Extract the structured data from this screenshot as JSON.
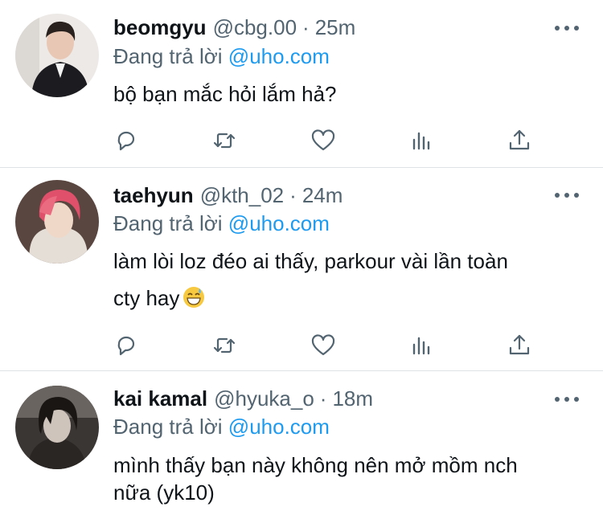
{
  "reply_prefix": "Đang trả lời",
  "colors": {
    "link": "#1d9bf0",
    "secondary": "#536471",
    "text": "#0f1419",
    "divider": "#dfe3e6"
  },
  "icons": [
    "reply-icon",
    "retweet-icon",
    "like-icon",
    "stats-icon",
    "share-icon",
    "more-icon"
  ],
  "tweets": [
    {
      "name": "beomgyu",
      "handle": "@cbg.00",
      "time": "25m",
      "reply_to": "@uho.com",
      "lines": [
        "bộ bạn mắc hỏi lắm hả?"
      ]
    },
    {
      "name": "taehyun",
      "handle": "@kth_02",
      "time": "24m",
      "reply_to": "@uho.com",
      "lines": [
        "làm lòi loz đéo ai thấy, parkour vài lần toàn",
        "cty hay"
      ],
      "emoji": "grinning-sweat-emoji"
    },
    {
      "name": "kai kamal",
      "handle": "@hyuka_o",
      "time": "18m",
      "reply_to": "@uho.com",
      "lines": [
        "mình thấy bạn này không nên mở mồm nch",
        "nữa (yk10)"
      ]
    }
  ]
}
